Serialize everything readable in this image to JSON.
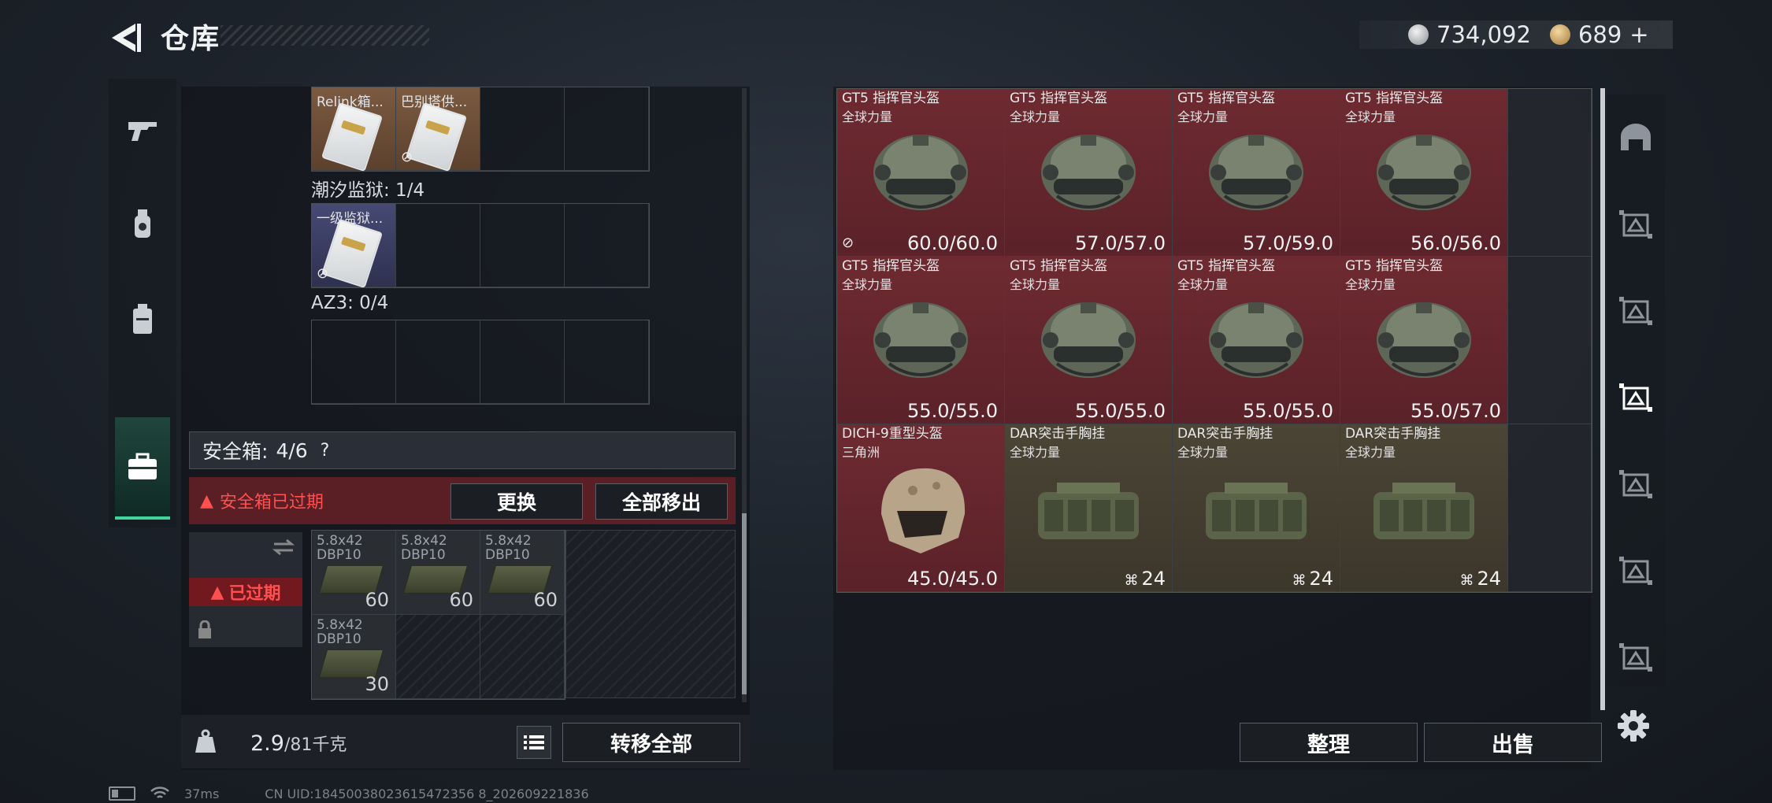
{
  "header": {
    "title": "仓库",
    "silver_amount": "734,092",
    "gold_amount": "689",
    "gold_add": "+"
  },
  "left_tabs": [
    "gun-icon",
    "grenade-icon",
    "backpack-icon",
    "briefcase-icon"
  ],
  "containers": {
    "top_items": [
      {
        "label": "Relink箱...",
        "color": "brown",
        "bound": false
      },
      {
        "label": "巴别塔供...",
        "color": "brown",
        "bound": true
      }
    ],
    "tide_prison": {
      "label": "潮汐监狱: 1/4",
      "items": [
        {
          "label": "一级监狱...",
          "color": "blue",
          "bound": true
        }
      ]
    },
    "az3": {
      "label": "AZ3: 0/4"
    }
  },
  "safe_box": {
    "title": "安全箱:",
    "count": "4/6",
    "help": "?",
    "expired_warning": "安全箱已过期",
    "replace_label": "更换",
    "remove_all_label": "全部移出",
    "case_expired": "已过期",
    "ammo": [
      {
        "name": "5.8x42",
        "sub": "DBP10",
        "count": "60"
      },
      {
        "name": "5.8x42",
        "sub": "DBP10",
        "count": "60"
      },
      {
        "name": "5.8x42",
        "sub": "DBP10",
        "count": "60"
      },
      {
        "name": "5.8x42",
        "sub": "DBP10",
        "count": "30"
      }
    ]
  },
  "weight": {
    "current": "2.9",
    "max": "/81千克",
    "unit_icon": "KG"
  },
  "transfer_all_label": "转移全部",
  "stash_items": [
    {
      "name": "GT5 指挥官头盔",
      "sub": "全球力量",
      "value": "60.0/60.0",
      "type": "helmet",
      "bg": "red",
      "bound": true
    },
    {
      "name": "GT5 指挥官头盔",
      "sub": "全球力量",
      "value": "57.0/57.0",
      "type": "helmet",
      "bg": "red"
    },
    {
      "name": "GT5 指挥官头盔",
      "sub": "全球力量",
      "value": "57.0/59.0",
      "type": "helmet",
      "bg": "red"
    },
    {
      "name": "GT5 指挥官头盔",
      "sub": "全球力量",
      "value": "56.0/56.0",
      "type": "helmet",
      "bg": "red"
    },
    {
      "name": "GT5 指挥官头盔",
      "sub": "全球力量",
      "value": "55.0/55.0",
      "type": "helmet",
      "bg": "red"
    },
    {
      "name": "GT5 指挥官头盔",
      "sub": "全球力量",
      "value": "55.0/55.0",
      "type": "helmet",
      "bg": "red"
    },
    {
      "name": "GT5 指挥官头盔",
      "sub": "全球力量",
      "value": "55.0/55.0",
      "type": "helmet",
      "bg": "red"
    },
    {
      "name": "GT5 指挥官头盔",
      "sub": "全球力量",
      "value": "55.0/57.0",
      "type": "helmet",
      "bg": "red"
    },
    {
      "name": "DICH-9重型头盔",
      "sub": "三角洲",
      "value": "45.0/45.0",
      "type": "heavy-helmet",
      "bg": "red"
    },
    {
      "name": "DAR突击手胸挂",
      "sub": "全球力量",
      "value": "24",
      "type": "vest",
      "bg": "olive"
    },
    {
      "name": "DAR突击手胸挂",
      "sub": "全球力量",
      "value": "24",
      "type": "vest",
      "bg": "olive"
    },
    {
      "name": "DAR突击手胸挂",
      "sub": "全球力量",
      "value": "24",
      "type": "vest",
      "bg": "olive"
    }
  ],
  "stash_buttons": {
    "sort": "整理",
    "sell": "出售"
  },
  "right_tabs": [
    "vault-icon",
    "stash-page-1-icon",
    "stash-page-2-icon",
    "stash-page-3-icon",
    "stash-page-4-icon",
    "stash-page-5-icon",
    "stash-page-6-icon"
  ],
  "footer": {
    "ping": "37ms",
    "uid": "CN UID:18450038023615472356 8_202609221836"
  },
  "colors": {
    "accent_green": "#41d39a",
    "expired_red": "#ff4f4f",
    "item_red": "#6e2a31",
    "item_olive": "#4b4536"
  }
}
